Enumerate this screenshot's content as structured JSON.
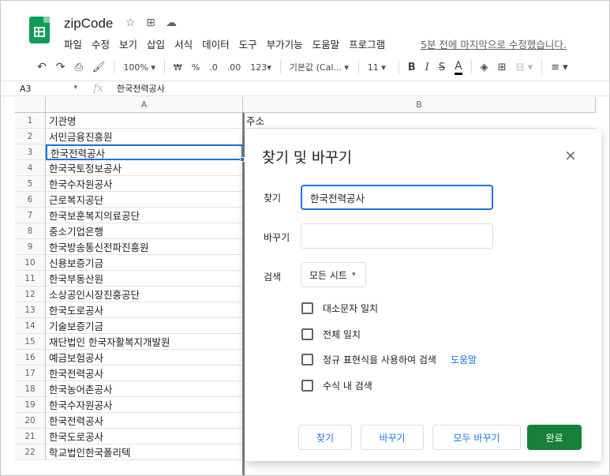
{
  "app": {
    "doc_title": "zipCode",
    "menu": [
      "파일",
      "수정",
      "보기",
      "삽입",
      "서식",
      "데이터",
      "도구",
      "부가기능",
      "도움말",
      "프로그램"
    ],
    "last_edit": "5분 전에 마지막으로 수정했습니다."
  },
  "toolbar": {
    "zoom": "100%",
    "currency": "₩",
    "percent": "%",
    "dec_less": ".0",
    "dec_more": ".00",
    "more_formats": "123",
    "font": "기본값 (Cal...",
    "font_size": "11",
    "bold": "B",
    "italic": "I",
    "strike": "S",
    "text_color": "A"
  },
  "formula_bar": {
    "cell_ref": "A3",
    "fx": "fx",
    "value": "한국전력공사"
  },
  "grid": {
    "col_a": "A",
    "col_b": "B",
    "b1": "주소",
    "rows": [
      {
        "num": "1",
        "a": "기관명"
      },
      {
        "num": "2",
        "a": "서민금융진흥원"
      },
      {
        "num": "3",
        "a": "한국전력공사"
      },
      {
        "num": "4",
        "a": "한국국토정보공사"
      },
      {
        "num": "5",
        "a": "한국수자원공사"
      },
      {
        "num": "6",
        "a": "근로복지공단"
      },
      {
        "num": "7",
        "a": "한국보훈복지의료공단"
      },
      {
        "num": "8",
        "a": "중소기업은행"
      },
      {
        "num": "9",
        "a": "한국방송통신전파진흥원"
      },
      {
        "num": "10",
        "a": "신용보증기금"
      },
      {
        "num": "11",
        "a": "한국부동산원"
      },
      {
        "num": "12",
        "a": "소상공인시장진흥공단"
      },
      {
        "num": "13",
        "a": "한국도로공사"
      },
      {
        "num": "14",
        "a": "기술보증기금"
      },
      {
        "num": "15",
        "a": "재단법인 한국자활복지개발원"
      },
      {
        "num": "16",
        "a": "예금보험공사"
      },
      {
        "num": "17",
        "a": "한국전력공사"
      },
      {
        "num": "18",
        "a": "한국농어촌공사"
      },
      {
        "num": "19",
        "a": "한국수자원공사"
      },
      {
        "num": "20",
        "a": "한국전력공사"
      },
      {
        "num": "21",
        "a": "한국도로공사"
      },
      {
        "num": "22",
        "a": "학교법인한국폴리텍"
      }
    ]
  },
  "dialog": {
    "title": "찾기 및 바꾸기",
    "close": "×",
    "find_label": "찾기",
    "find_value": "한국전력공사",
    "replace_label": "바꾸기",
    "replace_value": "",
    "search_label": "검색",
    "search_scope": "모든 시트",
    "options": {
      "match_case": "대소문자 일치",
      "match_entire": "전체 일치",
      "regex": "정규 표현식을 사용하여 검색",
      "help": "도움말",
      "in_formulas": "수식 내 검색"
    },
    "buttons": {
      "find": "찾기",
      "replace": "바꾸기",
      "replace_all": "모두 바꾸기",
      "done": "완료"
    }
  }
}
